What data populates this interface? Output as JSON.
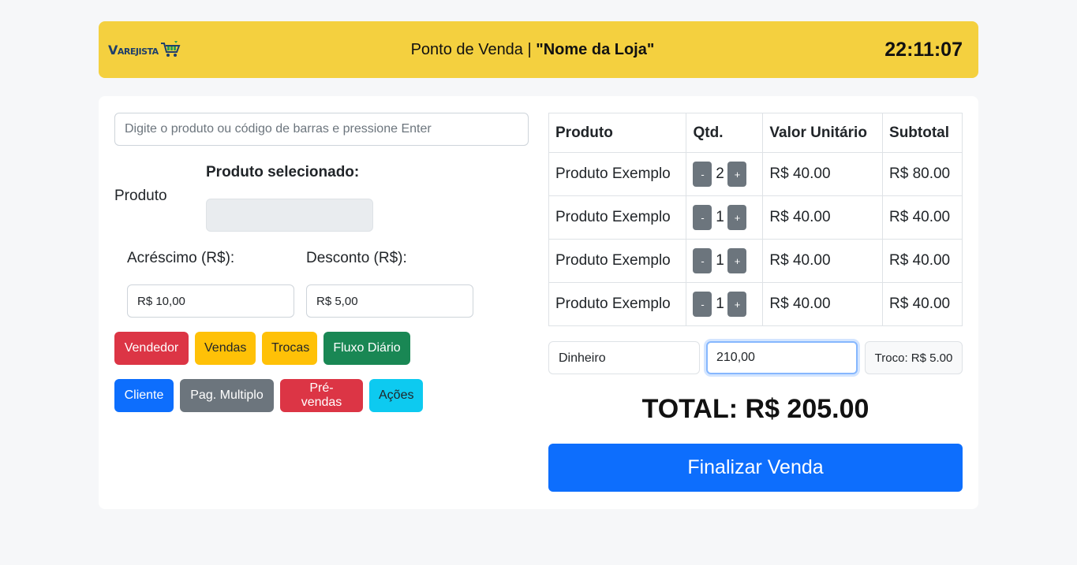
{
  "header": {
    "logo_text": "Varejista",
    "title_prefix": "Ponto de Venda | ",
    "store_name": "\"Nome da Loja\"",
    "clock": "22:11:07",
    "accent_color": "#f4d03f"
  },
  "left": {
    "search_placeholder": "Digite o produto ou código de barras e pressione Enter",
    "produto_label": "Produto",
    "selected_label": "Produto selecionado:",
    "acrescimo_label": "Acréscimo (R$):",
    "acrescimo_value": "R$ 10,00",
    "desconto_label": "Desconto (R$):",
    "desconto_value": "R$ 5,00",
    "buttons_row1": [
      "Vendedor",
      "Vendas",
      "Trocas",
      "Fluxo Diário"
    ],
    "buttons_row2": [
      "Cliente",
      "Pag. Multiplo",
      "Pré-vendas",
      "Ações"
    ]
  },
  "table": {
    "headers": [
      "Produto",
      "Qtd.",
      "Valor Unitário",
      "Subtotal"
    ],
    "rows": [
      {
        "produto": "Produto Exemplo",
        "qtd": "2",
        "valor": "R$ 40.00",
        "subtotal": "R$ 80.00"
      },
      {
        "produto": "Produto Exemplo",
        "qtd": "1",
        "valor": "R$ 40.00",
        "subtotal": "R$ 40.00"
      },
      {
        "produto": "Produto Exemplo",
        "qtd": "1",
        "valor": "R$ 40.00",
        "subtotal": "R$ 40.00"
      },
      {
        "produto": "Produto Exemplo",
        "qtd": "1",
        "valor": "R$ 40.00",
        "subtotal": "R$ 40.00"
      }
    ],
    "minus": "-",
    "plus": "+"
  },
  "payment": {
    "method": "Dinheiro",
    "paid_value": "210,00",
    "change": "Troco: R$ 5.00"
  },
  "total": "TOTAL: R$ 205.00",
  "finalize_label": "Finalizar Venda"
}
